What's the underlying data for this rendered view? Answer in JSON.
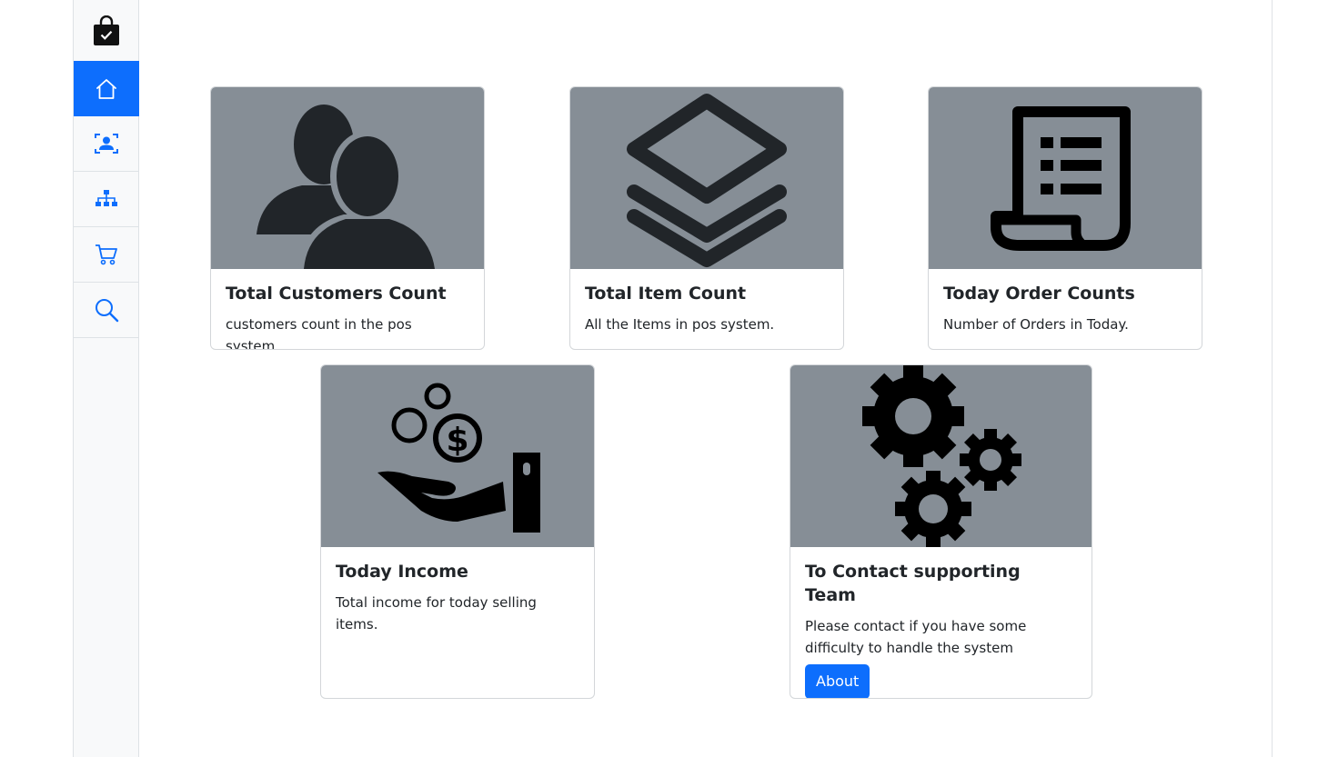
{
  "sidebar": {
    "logo_icon": "shopping-bag-check-icon",
    "items": [
      {
        "name": "home",
        "icon": "house-icon",
        "active": true
      },
      {
        "name": "customers",
        "icon": "person-badge-icon"
      },
      {
        "name": "items",
        "icon": "diagram-icon"
      },
      {
        "name": "orders",
        "icon": "cart-icon"
      },
      {
        "name": "search",
        "icon": "search-icon"
      }
    ]
  },
  "cards": {
    "customers": {
      "title": "Total Customers Count",
      "text": "customers count in the pos system.",
      "icon": "users-icon"
    },
    "items": {
      "title": "Total Item Count",
      "text": "All the Items in pos system.",
      "icon": "layers-icon"
    },
    "orders": {
      "title": "Today Order Counts",
      "text": "Number of Orders in Today.",
      "icon": "receipt-icon"
    },
    "income": {
      "title": "Today Income",
      "text": "Total income for today selling items.",
      "icon": "hand-coins-icon"
    },
    "contact": {
      "title": "To Contact supporting Team",
      "text": "Please contact if you have some difficulty to handle the system",
      "button": "About",
      "icon": "gears-icon"
    }
  },
  "colors": {
    "accent": "#0d6efd",
    "card_image_bg": "#868e96",
    "icon_dark": "#212529"
  }
}
